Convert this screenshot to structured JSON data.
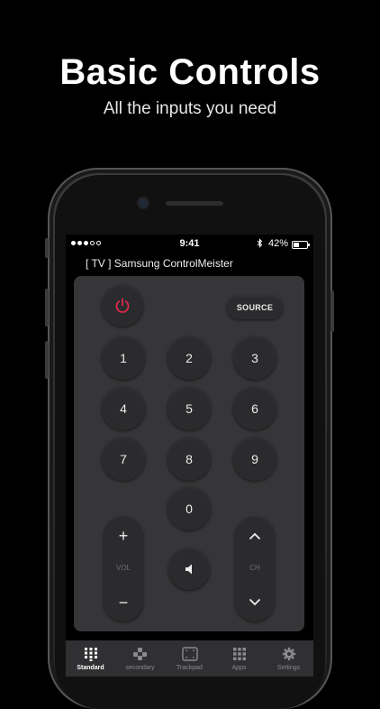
{
  "promo": {
    "headline": "Basic Controls",
    "subline": "All the inputs you need"
  },
  "status_bar": {
    "time": "9:41",
    "battery_text": "42%",
    "battery_level": 0.42,
    "signal_dots_filled": 3,
    "signal_dots_total": 5
  },
  "device": {
    "title": "[ TV ] Samsung ControlMeister"
  },
  "remote": {
    "power_icon": "power-icon",
    "source_label": "SOURCE",
    "keys": [
      "1",
      "2",
      "3",
      "4",
      "5",
      "6",
      "7",
      "8",
      "9",
      "0"
    ],
    "volume": {
      "up": "+",
      "label": "VOL",
      "down": "−"
    },
    "channel": {
      "label": "CH",
      "up_icon": "chevron-up-icon",
      "down_icon": "chevron-down-icon"
    },
    "mute_icon": "speaker-icon"
  },
  "tabs": [
    {
      "label": "Standard",
      "icon": "keypad-icon",
      "active": true
    },
    {
      "label": "secondary",
      "icon": "gamepad-icon",
      "active": false
    },
    {
      "label": "Trackpad",
      "icon": "trackpad-icon",
      "active": false
    },
    {
      "label": "Apps",
      "icon": "apps-grid-icon",
      "active": false
    },
    {
      "label": "Settings",
      "icon": "gear-icon",
      "active": false
    }
  ],
  "colors": {
    "power_accent": "#e0284b",
    "panel": "#363638",
    "button": "#2b2b2d",
    "tabbar": "#303032"
  }
}
